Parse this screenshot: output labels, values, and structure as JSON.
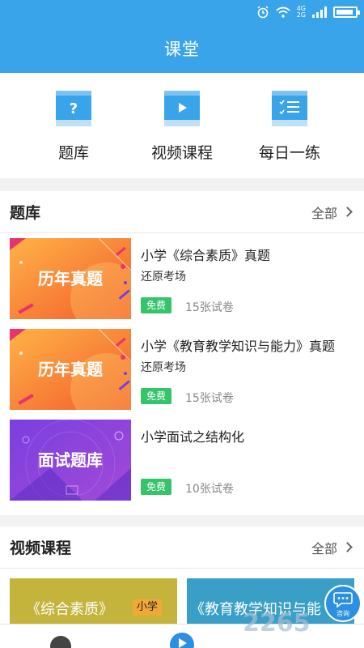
{
  "status_bar": {
    "network_top": "4G",
    "network_bottom": "2G"
  },
  "header": {
    "title": "课堂"
  },
  "quick_nav": [
    {
      "label": "题库",
      "icon": "question-bank-icon"
    },
    {
      "label": "视频课程",
      "icon": "video-play-icon"
    },
    {
      "label": "每日一练",
      "icon": "checklist-icon"
    }
  ],
  "question_bank": {
    "title": "题库",
    "more_label": "全部",
    "items": [
      {
        "thumb_text": "历年真题",
        "title": "小学《综合素质》真题",
        "subtitle": "还原考场",
        "badge": "免费",
        "count": "15张试卷"
      },
      {
        "thumb_text": "历年真题",
        "title": "小学《教育教学知识与能力》真题",
        "subtitle": "还原考场",
        "badge": "免费",
        "count": "15张试卷"
      },
      {
        "thumb_text": "面试题库",
        "title": "小学面试之结构化",
        "subtitle": "",
        "badge": "免费",
        "count": "10张试卷"
      }
    ]
  },
  "video_courses": {
    "title": "视频课程",
    "more_label": "全部",
    "cards": [
      {
        "text": "《综合素质》",
        "tag": "小学"
      },
      {
        "text": "《教育教学知识与能"
      }
    ]
  },
  "consult_label": "咨询",
  "watermark": "2265",
  "colors": {
    "primary": "#3aa4ea",
    "free_badge": "#35c46a"
  }
}
